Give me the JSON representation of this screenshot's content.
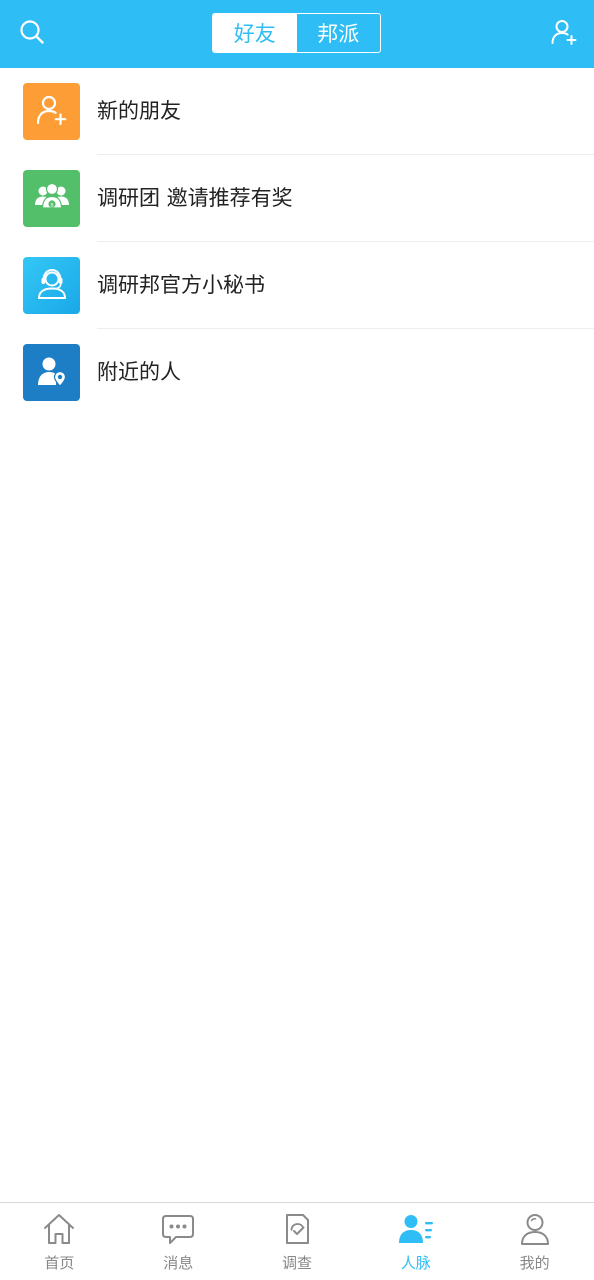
{
  "colors": {
    "primary": "#2ebef5",
    "icon_orange": "#fd9d35",
    "icon_green": "#54bf6b",
    "icon_cyan": "#1eb6f0",
    "icon_blue": "#1d7dc5",
    "tab_inactive": "#888888"
  },
  "header": {
    "search_icon": "search-icon",
    "add_friend_icon": "add-user-icon",
    "segments": [
      {
        "label": "好友",
        "active": true
      },
      {
        "label": "邦派",
        "active": false
      }
    ]
  },
  "list": {
    "items": [
      {
        "label": "新的朋友",
        "icon": "add-user-icon",
        "color": "#fd9d35"
      },
      {
        "label": "调研团 邀请推荐有奖",
        "icon": "group-money-icon",
        "color": "#54bf6b"
      },
      {
        "label": "调研邦官方小秘书",
        "icon": "customer-service-icon",
        "color": "#1eb6f0"
      },
      {
        "label": "附近的人",
        "icon": "person-location-icon",
        "color": "#1d7dc5"
      }
    ]
  },
  "tabbar": {
    "tabs": [
      {
        "label": "首页",
        "icon": "home-icon",
        "active": false
      },
      {
        "label": "消息",
        "icon": "message-icon",
        "active": false
      },
      {
        "label": "调查",
        "icon": "survey-icon",
        "active": false
      },
      {
        "label": "人脉",
        "icon": "contacts-icon",
        "active": true
      },
      {
        "label": "我的",
        "icon": "profile-icon",
        "active": false
      }
    ]
  }
}
